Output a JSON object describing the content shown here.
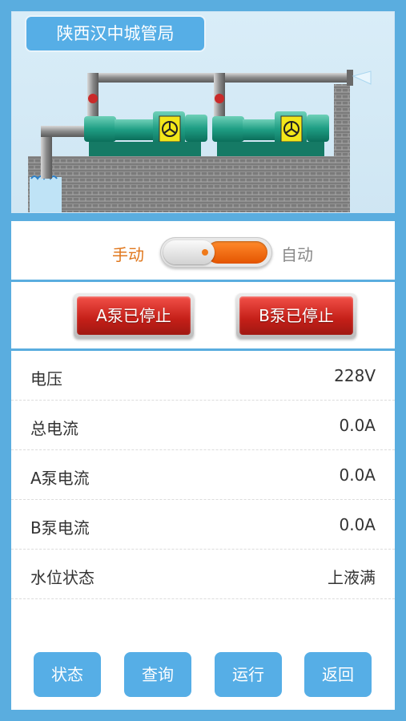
{
  "header": {
    "title": "陕西汉中城管局"
  },
  "mode": {
    "manual_label": "手动",
    "auto_label": "自动",
    "selected": "manual"
  },
  "pumps": [
    {
      "label": "A泵已停止"
    },
    {
      "label": "B泵已停止"
    }
  ],
  "readings": [
    {
      "label": "电压",
      "value": "228V"
    },
    {
      "label": "总电流",
      "value": "0.0A"
    },
    {
      "label": "A泵电流",
      "value": "0.0A"
    },
    {
      "label": "B泵电流",
      "value": "0.0A"
    },
    {
      "label": "水位状态",
      "value": "上液满"
    }
  ],
  "nav": [
    {
      "label": "状态"
    },
    {
      "label": "查询"
    },
    {
      "label": "运行"
    },
    {
      "label": "返回"
    }
  ],
  "colors": {
    "background": "#5aaddf",
    "accent_blue": "#56aee6",
    "manual_orange": "#e0771c",
    "pump_stopped_red": "#c41f18"
  }
}
